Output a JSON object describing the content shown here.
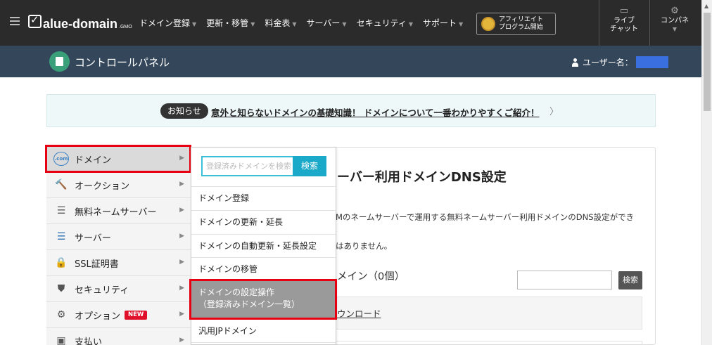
{
  "brand": {
    "logo_text": "alue-domain",
    "logo_suffix": ".GMO"
  },
  "topnav": {
    "menu": [
      {
        "label": "ドメイン登録"
      },
      {
        "label": "更新・移管"
      },
      {
        "label": "料金表"
      },
      {
        "label": "サーバー"
      },
      {
        "label": "セキュリティ"
      },
      {
        "label": "サポート"
      }
    ],
    "affiliate_line1": "アフィリエイト",
    "affiliate_line2": "プログラム開始",
    "live_chat_line1": "ライブ",
    "live_chat_line2": "チャット",
    "control_panel_label": "コンパネ"
  },
  "cpbar": {
    "title": "コントロールパネル",
    "user_label": "ユーザー名："
  },
  "notice": {
    "badge": "お知らせ",
    "text": "意外と知らないドメインの基礎知識！ ドメインについて一番わかりやすくご紹介！"
  },
  "sidebar": {
    "items": [
      {
        "label": "ドメイン",
        "icon": "globe-icon"
      },
      {
        "label": "オークション",
        "icon": "gavel-icon"
      },
      {
        "label": "無料ネームサーバー",
        "icon": "server-icon"
      },
      {
        "label": "サーバー",
        "icon": "server-stack-icon"
      },
      {
        "label": "SSL証明書",
        "icon": "ssl-lock-icon"
      },
      {
        "label": "セキュリティ",
        "icon": "shield-icon"
      },
      {
        "label": "オプション",
        "icon": "gears-icon",
        "badge": "NEW"
      },
      {
        "label": "支払い",
        "icon": "wallet-icon"
      }
    ]
  },
  "dropdown": {
    "search_placeholder": "登録済みドメインを検索",
    "search_button": "検索",
    "items": [
      {
        "label": "ドメイン登録"
      },
      {
        "label": "ドメインの更新・延長"
      },
      {
        "label": "ドメインの自動更新・延長設定"
      },
      {
        "label": "ドメインの移管"
      },
      {
        "label": "ドメインの設定操作",
        "label2": "（登録済みドメイン一覧）"
      },
      {
        "label": "汎用JPドメイン"
      }
    ]
  },
  "main": {
    "title": "ーバー利用ドメインDNS設定",
    "desc1": "Mのネームサーバーで運用する無料ネームサーバー利用ドメインのDNS設定ができ",
    "desc2": "はありません。",
    "subheading": "メイン（0個）",
    "search_button": "検索",
    "download_link": "ウンロード"
  },
  "colors": {
    "highlight": "#e60012",
    "accent": "#1aa9c8",
    "header_bg": "#2b2b2b",
    "cpbar_bg": "#33465a"
  }
}
